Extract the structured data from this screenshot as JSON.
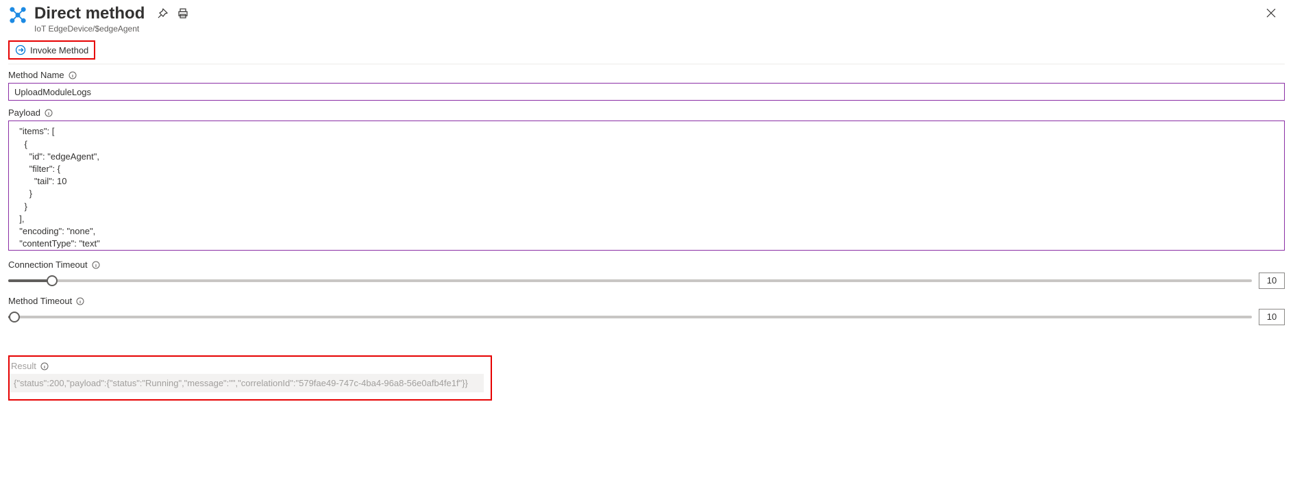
{
  "header": {
    "title": "Direct method",
    "breadcrumb": "IoT EdgeDevice/$edgeAgent"
  },
  "toolbar": {
    "invoke_label": "Invoke Method"
  },
  "form": {
    "method_name": {
      "label": "Method Name",
      "value": "UploadModuleLogs"
    },
    "payload": {
      "label": "Payload",
      "value": "  \"items\": [\n    {\n      \"id\": \"edgeAgent\",\n      \"filter\": {\n        \"tail\": 10\n      }\n    }\n  ],\n  \"encoding\": \"none\",\n  \"contentType\": \"text\""
    },
    "connection_timeout": {
      "label": "Connection Timeout",
      "value": "10",
      "fill_percent": 3.5
    },
    "method_timeout": {
      "label": "Method Timeout",
      "value": "10",
      "fill_percent": 0.5
    }
  },
  "result": {
    "label": "Result",
    "value": "{\"status\":200,\"payload\":{\"status\":\"Running\",\"message\":\"\",\"correlationId\":\"579fae49-747c-4ba4-96a8-56e0afb4fe1f\"}}"
  }
}
